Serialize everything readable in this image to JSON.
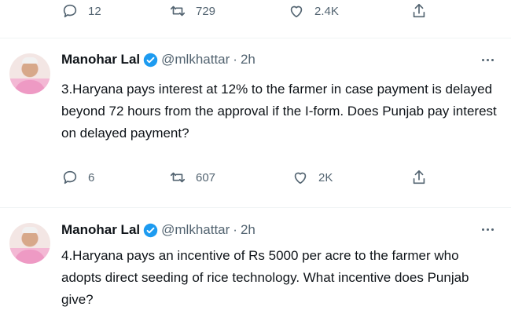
{
  "top_actions": {
    "reply_count": "12",
    "retweet_count": "729",
    "like_count": "2.4K"
  },
  "tweets": [
    {
      "name": "Manohar Lal",
      "handle": "@mlkhattar",
      "separator": "·",
      "time": "2h",
      "text": "3.Haryana pays interest at 12% to the farmer in case payment is delayed beyond 72 hours from the approval if the I-form. Does Punjab pay interest on delayed payment?",
      "reply_count": "6",
      "retweet_count": "607",
      "like_count": "2K"
    },
    {
      "name": "Manohar Lal",
      "handle": "@mlkhattar",
      "separator": "·",
      "time": "2h",
      "text": "4.Haryana pays an incentive of Rs 5000 per acre to the farmer who adopts direct seeding of rice technology. What incentive does Punjab give?"
    }
  ],
  "icons": [
    "reply-icon",
    "retweet-icon",
    "like-icon",
    "share-icon",
    "verified-badge-icon",
    "more-icon"
  ],
  "colors": {
    "text": "#0f1419",
    "muted": "#536471",
    "verified": "#1d9bf0",
    "divider": "#eff3f4"
  }
}
